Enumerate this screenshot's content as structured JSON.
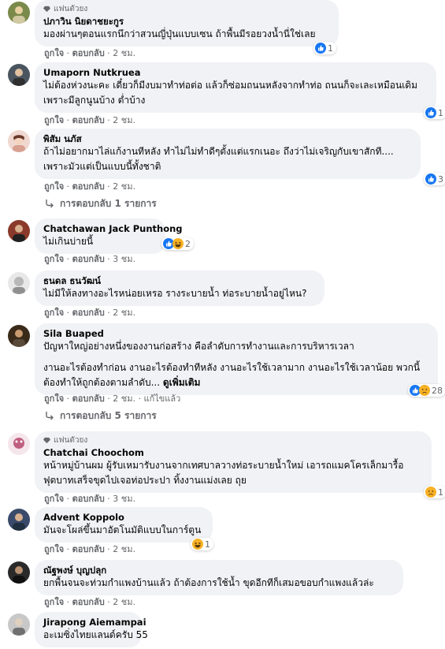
{
  "comments": [
    {
      "fan_label": "แฟนตัวยง",
      "name": "ปภาวิน นิยดาชยะกูร",
      "lines": [
        "มองผ่านๆตอนแรกนึกว่าสวนญี่ปุ่นแบบเซน ถ้าพื้นมีรอยวงน้ำนี่ใช่เลย"
      ],
      "like": "ถูกใจ",
      "reply": "ตอบกลับ",
      "time": "2 ชม.",
      "reaction_count": "1",
      "avatar_color": "#7a8a4a"
    },
    {
      "name": "Umaporn Nutkruea",
      "lines": [
        "ไม่ต้องห่วงนะคะ เดี๋ยวก็มีงบมาทำท่อต่อ แล้วก็ซ่อมถนนหลังจากทำท่อ ถนนก็จะเละเหมือนเดิม",
        "เพราะมีลูกนูนบ้าง ต่ำบ้าง"
      ],
      "like": "ถูกใจ",
      "reply": "ตอบกลับ",
      "time": "2 ชม.",
      "reaction_count": "1",
      "avatar_color": "#4a5560"
    },
    {
      "name": "พิสัม นภัส",
      "lines": [
        "ถ้าไม่อยากมาไล่แก้งานทีหลัง ทำไม่ไม่ทำดีๆตั้งแต่แรกเนอะ ถึงว่าไม่เจริญกับเขาสักที....",
        "เพราะมัวแต่เป็นแบบนี้ทั้งชาติ"
      ],
      "like": "ถูกใจ",
      "reply": "ตอบกลับ",
      "time": "2 ชม.",
      "reaction_count": "3",
      "replies_label": "การตอบกลับ 1 รายการ",
      "avatar_color": "#d8a090"
    },
    {
      "name": "Chatchawan Jack Punthong",
      "lines": [
        "ไม่เกินบ่ายนี้"
      ],
      "like": "ถูกใจ",
      "reply": "ตอบกลับ",
      "time": "3 ชม.",
      "reaction_count": "2",
      "avatar_color": "#8a3a2a"
    },
    {
      "name": "ธนดล ธนวัฒน์",
      "lines": [
        "ไม่มีให้ลงทางอะไรหน่อยเหรอ รางระบายน้ำ ท่อระบายน้ำอยู่ไหน?"
      ],
      "like": "ถูกใจ",
      "reply": "ตอบกลับ",
      "time": "2 ชม.",
      "avatar_color": "#c0c0c0"
    },
    {
      "name": "Sila Buaped",
      "lines": [
        "ปัญหาใหญ่อย่างหนึ่งของงานก่อสร้าง คือลำดับการทำงานและการบริหารเวลา"
      ],
      "lines2": [
        "งานอะไรต้องทำก่อน งานอะไรต้องทำทีหลัง งานอะไรใช้เวลามาก งานอะไรใช้เวลาน้อย พวกนี้",
        "ต้องทำให้ถูกต้องตามลำดับ..."
      ],
      "see_more": "ดูเพิ่มเติม",
      "like": "ถูกใจ",
      "reply": "ตอบกลับ",
      "time": "2 ชม.",
      "edited": "แก้ไขแล้ว",
      "reaction_count": "28",
      "replies_label": "การตอบกลับ 5 รายการ",
      "avatar_color": "#3a2a1a"
    },
    {
      "fan_label": "แฟนตัวยง",
      "name": "Chatchai Choochom",
      "lines": [
        "หน้าหมู่บ้านผม ผู้รับเหมารับงานจากเทศบาลวางท่อระบายน้ำใหม่ เอารถแมคโครเล็กมารื้อ",
        "ฟุตบาทเสร็จขุดไปเจอท่อประปา ทิ้งงานแม่งเลย ถุย"
      ],
      "like": "ถูกใจ",
      "reply": "ตอบกลับ",
      "time": "3 ชม.",
      "reaction_count": "1",
      "avatar_color": "#c06080"
    },
    {
      "name": "Advent Koppolo",
      "lines": [
        "มันจะโผล่ขึ้นมาอัตโนมัติแบบในการ์ตูน"
      ],
      "like": "ถูกใจ",
      "reply": "ตอบกลับ",
      "time": "2 ชม.",
      "reaction_count": "1",
      "avatar_color": "#3a4a6a"
    },
    {
      "name": "ณัฐพงษ์ บุญปลุก",
      "lines": [
        "ยกพื้นจนจะท่วมกำแพงบ้านแล้ว ถ้าต้องการใช้น้ำ ขุดอีกทีก็เสมอขอบกำแพงแล้วล่ะ"
      ],
      "like": "ถูกใจ",
      "reply": "ตอบกลับ",
      "time": "2 ชม.",
      "avatar_color": "#2a2a2a"
    },
    {
      "name": "Jirapong Aiemampai",
      "lines": [
        "อะเมซิ่งไทยแลนด์ครับ 55"
      ],
      "avatar_color": "#c8c8c8"
    }
  ],
  "colors": {
    "like_blue": "#1877f2",
    "haha_yellow": "#f7b125",
    "bubble": "#f0f2f5",
    "meta": "#65676b"
  }
}
